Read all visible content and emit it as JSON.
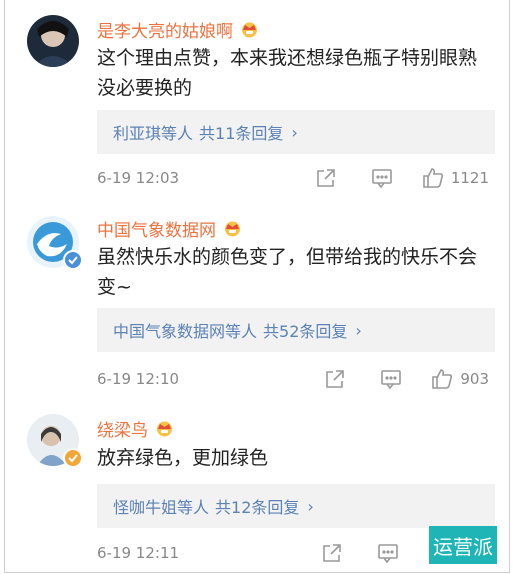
{
  "comments": [
    {
      "name": "是李大亮的姑娘啊",
      "text": "这个理由点赞，本来我还想绿色瓶子特别眼熟没必要换的",
      "reply_users": "利亚琪",
      "reply_etc": "等人",
      "reply_count": "共11条回复",
      "time": "6-19 12:03",
      "likes": "1121"
    },
    {
      "name": "中国气象数据网",
      "text": "虽然快乐水的颜色变了，但带给我的快乐不会变~",
      "reply_users": "中国气象数据网",
      "reply_etc": "等人",
      "reply_count": "共52条回复",
      "time": "6-19 12:10",
      "likes": "903"
    },
    {
      "name": "绕梁鸟",
      "text": "放弃绿色，更加绿色",
      "reply_users": "怪咖牛姐",
      "reply_etc": "等人",
      "reply_count": "共12条回复",
      "time": "6-19 12:11",
      "likes": ""
    }
  ],
  "icons": {
    "reply_chevron": "›",
    "badge": "crown-badge-icon",
    "share": "share-icon",
    "comment": "comment-icon",
    "like": "thumbs-up-icon"
  },
  "colors": {
    "name": "#eb7340",
    "link": "#5b82b5",
    "meta": "#888888",
    "reply_bg": "#f2f2f2",
    "watermark_bg": "#1fb4b6"
  },
  "watermark": {
    "text": "运营派"
  }
}
